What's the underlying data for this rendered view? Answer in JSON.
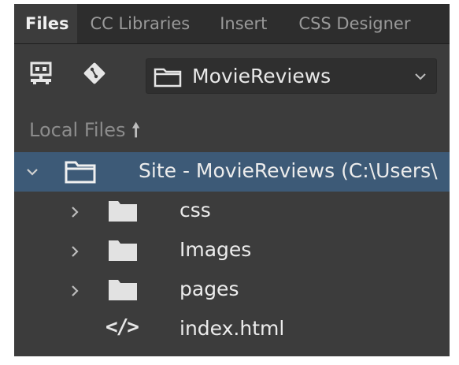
{
  "tabs": [
    {
      "label": "Files",
      "active": true
    },
    {
      "label": "CC Libraries",
      "active": false
    },
    {
      "label": "Insert",
      "active": false
    },
    {
      "label": "CSS Designer",
      "active": false
    }
  ],
  "toolbar": {
    "icons": [
      "network-connect-icon",
      "git-icon"
    ],
    "site_select": {
      "value": "MovieReviews",
      "icon": "folder-icon",
      "expand_icon": "chevron-down-icon"
    }
  },
  "section": {
    "label": "Local Files",
    "sort_icon": "arrow-up-icon"
  },
  "tree": {
    "root": {
      "label": "Site - MovieReviews (C:\\Users\\",
      "expanded": true,
      "selected": true,
      "icon": "folder-icon"
    },
    "children": [
      {
        "label": "css",
        "type": "folder",
        "icon": "folder-icon"
      },
      {
        "label": "Images",
        "type": "folder",
        "icon": "folder-icon"
      },
      {
        "label": "pages",
        "type": "folder",
        "icon": "folder-icon"
      },
      {
        "label": "index.html",
        "type": "file",
        "icon": "code-file-icon"
      }
    ]
  },
  "colors": {
    "panel_bg": "#3c3c3c",
    "tabbar_bg": "#2d2d2d",
    "selection": "#3d5a77",
    "text": "#ececec"
  }
}
